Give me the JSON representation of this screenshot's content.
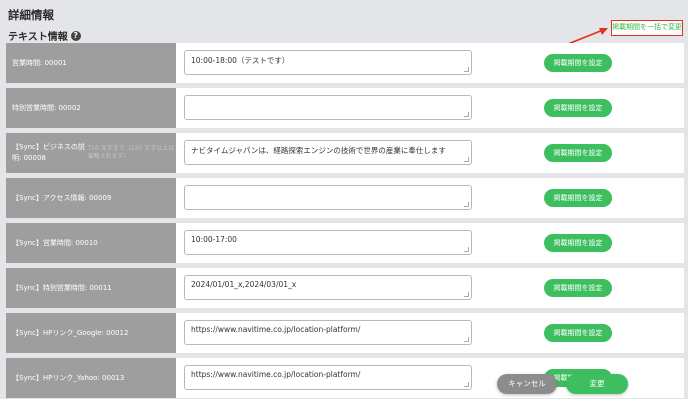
{
  "header": {
    "title": "詳細情報",
    "subtitle": "テキスト情報",
    "help_icon": "question-circle-icon",
    "help_glyph": "?",
    "bulk_button": "掲載期間を一括で変更"
  },
  "rows": [
    {
      "label": "営業時間: 00001",
      "note": "",
      "value": "10:00-18:00（テストです）",
      "button": "掲載期間を設定"
    },
    {
      "label": "特別営業時間: 00002",
      "note": "",
      "value": "",
      "button": "掲載期間を設定"
    },
    {
      "label": "【Sync】ビジネスの説明: 00008",
      "note": "750 文字まで（220 文字以上は省略されます）",
      "value": "ナビタイムジャパンは、経路探索エンジンの技術で世界の産業に奉仕します",
      "button": "掲載期間を設定"
    },
    {
      "label": "【Sync】アクセス情報: 00009",
      "note": "",
      "value": "",
      "button": "掲載期間を設定"
    },
    {
      "label": "【Sync】営業時間: 00010",
      "note": "",
      "value": "10:00-17:00",
      "button": "掲載期間を設定"
    },
    {
      "label": "【Sync】特別営業時間: 00011",
      "note": "",
      "value": "2024/01/01_x,2024/03/01_x",
      "button": "掲載期間を設定"
    },
    {
      "label": "【Sync】HPリンク_Google: 00012",
      "note": "",
      "value": "https://www.navitime.co.jp/location-platform/",
      "button": "掲載期間を設定"
    },
    {
      "label": "【Sync】HPリンク_Yahoo: 00013",
      "note": "",
      "value": "https://www.navitime.co.jp/location-platform/",
      "button": "掲載期間を設定"
    }
  ],
  "footer": {
    "cancel_label": "キャンセル",
    "save_label": "変更"
  },
  "colors": {
    "accent_green": "#3dbf60",
    "annotation_red": "#e0301e",
    "label_bg": "#9e9e9e"
  }
}
